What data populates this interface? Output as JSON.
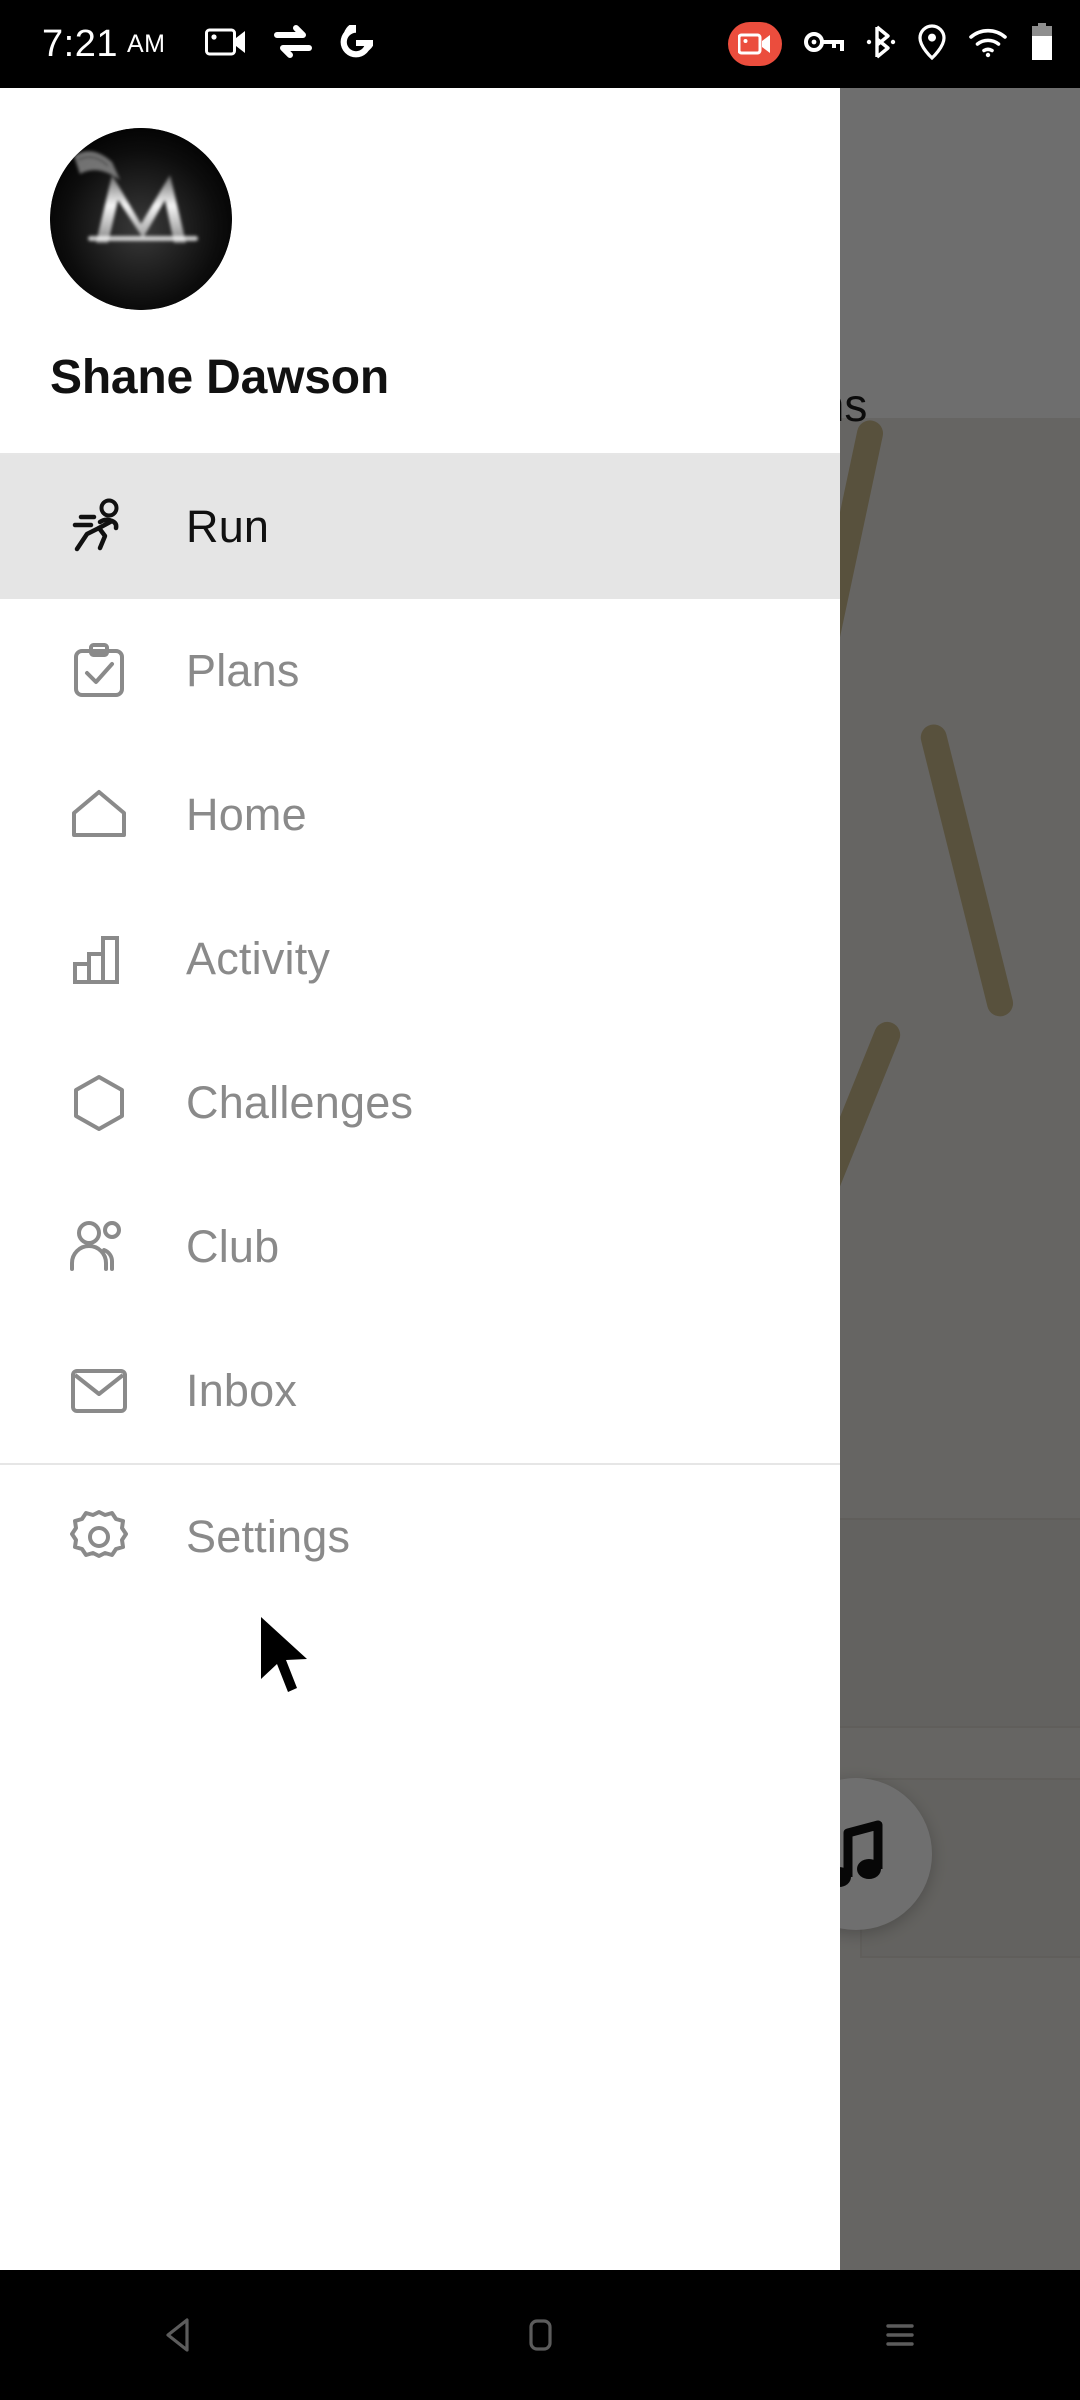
{
  "status_bar": {
    "time": "7:21",
    "ampm": "AM",
    "left_icons": [
      {
        "name": "screen-record-camera-icon"
      },
      {
        "name": "data-transfer-icon"
      },
      {
        "name": "google-g-icon"
      }
    ],
    "right_icons": [
      {
        "name": "screen-recording-active-icon",
        "color": "#eb4d3d"
      },
      {
        "name": "vpn-key-icon"
      },
      {
        "name": "bluetooth-icon"
      },
      {
        "name": "location-pin-icon"
      },
      {
        "name": "wifi-icon"
      },
      {
        "name": "battery-icon"
      }
    ]
  },
  "background": {
    "screen_title": "Runs",
    "music_button_label": "music-note-icon"
  },
  "drawer": {
    "profile": {
      "name": "Shane Dawson",
      "avatar_label": "monogram-m-avatar"
    },
    "nav_items": [
      {
        "label": "Run",
        "icon": "running-person-icon",
        "active": true
      },
      {
        "label": "Plans",
        "icon": "clipboard-check-icon",
        "active": false
      },
      {
        "label": "Home",
        "icon": "house-icon",
        "active": false
      },
      {
        "label": "Activity",
        "icon": "bar-chart-icon",
        "active": false
      },
      {
        "label": "Challenges",
        "icon": "hexagon-icon",
        "active": false
      },
      {
        "label": "Club",
        "icon": "people-group-icon",
        "active": false
      },
      {
        "label": "Inbox",
        "icon": "envelope-icon",
        "active": false
      }
    ],
    "settings_item": {
      "label": "Settings",
      "icon": "gear-icon",
      "active": false
    }
  },
  "nav_bar": {
    "back_label": "back-triangle-icon",
    "home_label": "home-square-icon",
    "recents_label": "recent-apps-icon"
  },
  "colors": {
    "accent_red": "#eb4d3d",
    "drawer_bg": "#ffffff",
    "active_row_bg": "#e5e5e5",
    "label_gray": "#8a8a8a",
    "label_dark": "#111111",
    "scrim": "rgba(0,0,0,0.56)"
  }
}
